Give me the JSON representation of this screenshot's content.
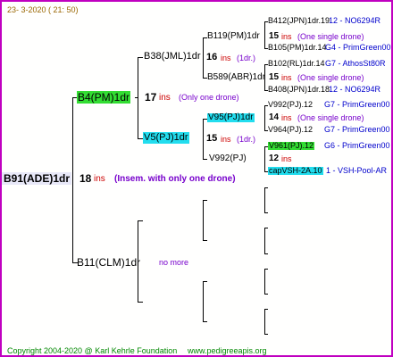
{
  "header": {
    "date": "23-  3-2020 (  21: 50)"
  },
  "footer": {
    "copyright": "Copyright 2004-2020 @ Karl Kehrle Foundation",
    "site": "www.pedigreeapis.org"
  },
  "colors": {
    "frame": "#c000c0",
    "green_box": "#33dd33",
    "cyan_box": "#22ddee",
    "lavender_box": "#e8e8f8",
    "red_text": "#cc0000",
    "purple_text": "#7700cc",
    "blue_text": "#0000cc"
  },
  "root": {
    "label": "B91(ADE)1dr",
    "num": "18",
    "ins": "ins",
    "note": "(Insem. with only one drone)"
  },
  "gen1": [
    {
      "label": "B4(PM)1dr",
      "num": "17",
      "ins": "ins",
      "note": "(Only one drone)"
    },
    {
      "label": "B11(CLM)1dr",
      "note": "no more"
    }
  ],
  "gen2": [
    {
      "label": "B38(JML)1dr",
      "num": "16",
      "ins": "ins",
      "note": "(1dr.)"
    },
    {
      "label": "V5(PJ)1dr",
      "num": "15",
      "ins": "ins",
      "note": "(1dr.)"
    }
  ],
  "gen3": [
    {
      "label": "B119(PM)1dr",
      "num": "15",
      "ins": "ins",
      "note": "(One single drone)"
    },
    {
      "label": "B589(ABR)1dr",
      "num": "15",
      "ins": "ins",
      "note": "(One single drone)"
    },
    {
      "label": "V95(PJ)1dr",
      "num": "14",
      "ins": "ins",
      "note": "(One single drone)"
    },
    {
      "label": "V992(PJ)",
      "num": "12",
      "ins": "ins"
    }
  ],
  "gen4": [
    {
      "label": "B412(JPN)1dr.19",
      "tail": "12 - NO6294R"
    },
    {
      "label": "B105(PM)1dr.14",
      "tail": "G4 - PrimGreen00"
    },
    {
      "label": "B102(RL)1dr.14",
      "tail": "G7 - AthosSt80R"
    },
    {
      "label": "B408(JPN)1dr.18",
      "tail": "12 - NO6294R"
    },
    {
      "label": "V992(PJ).12",
      "tail": "G7 - PrimGreen00"
    },
    {
      "label": "V964(PJ).12",
      "tail": "G7 - PrimGreen00"
    },
    {
      "label": "V961(PJ).12",
      "tail": "G6 - PrimGreen00"
    },
    {
      "label": "capVSH-2A.10",
      "tail": "1 - VSH-Pool-AR"
    }
  ]
}
